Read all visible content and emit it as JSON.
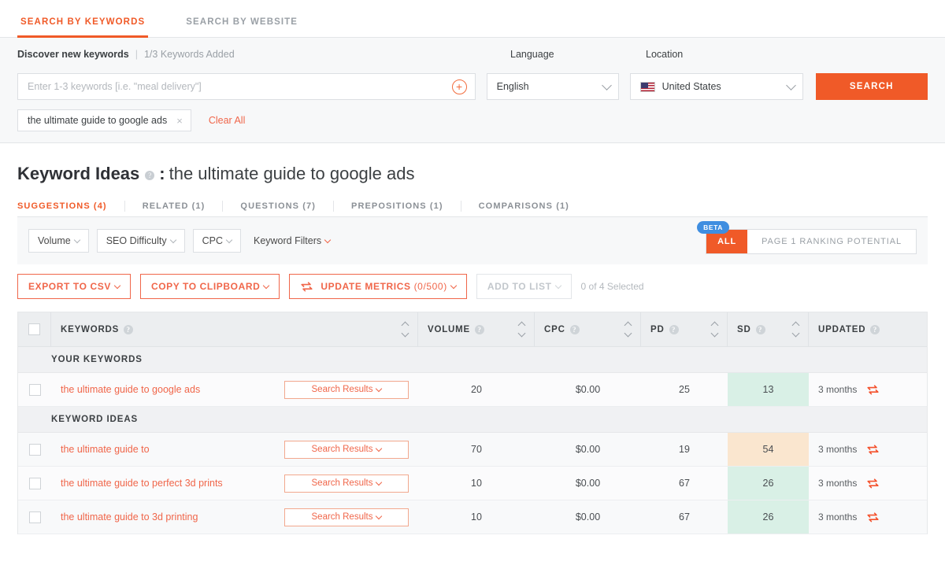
{
  "top_tabs": [
    {
      "label": "SEARCH BY KEYWORDS",
      "active": true
    },
    {
      "label": "SEARCH BY WEBSITE",
      "active": false
    }
  ],
  "search_panel": {
    "discover_label": "Discover new keywords",
    "separator": "|",
    "added_label": "1/3 Keywords Added",
    "keyword_input_placeholder": "Enter 1-3 keywords [i.e. \"meal delivery\"]",
    "keyword_input_value": "",
    "language_label": "Language",
    "language_value": "English",
    "location_label": "Location",
    "location_value": "United States",
    "search_button": "SEARCH",
    "chips": [
      {
        "label": "the ultimate guide to google ads",
        "remove": "×"
      }
    ],
    "clear_all": "Clear All"
  },
  "heading": {
    "title": "Keyword Ideas",
    "info": "?",
    "colon": ":",
    "query": "the ultimate guide to google ads"
  },
  "sub_tabs": [
    {
      "label": "SUGGESTIONS (4)",
      "active": true
    },
    {
      "label": "RELATED (1)",
      "active": false
    },
    {
      "label": "QUESTIONS (7)",
      "active": false
    },
    {
      "label": "PREPOSITIONS (1)",
      "active": false
    },
    {
      "label": "COMPARISONS (1)",
      "active": false
    }
  ],
  "filters": {
    "chips": [
      "Volume",
      "SEO Difficulty",
      "CPC"
    ],
    "keyword_filters": "Keyword Filters",
    "toggle": {
      "beta_badge": "BETA",
      "all": "ALL",
      "page1": "PAGE 1 RANKING POTENTIAL"
    }
  },
  "actions": {
    "export": "EXPORT TO CSV",
    "copy": "COPY TO CLIPBOARD",
    "update_metrics": "UPDATE METRICS",
    "update_metrics_count": "(0/500)",
    "add_to_list": "ADD TO LIST",
    "selected_count": "0 of 4 Selected"
  },
  "table": {
    "columns": [
      {
        "key": "keywords",
        "label": "KEYWORDS",
        "sortable": true,
        "info": true
      },
      {
        "key": "volume",
        "label": "VOLUME",
        "sortable": true,
        "info": true
      },
      {
        "key": "cpc",
        "label": "CPC",
        "sortable": true,
        "info": true
      },
      {
        "key": "pd",
        "label": "PD",
        "sortable": true,
        "info": true
      },
      {
        "key": "sd",
        "label": "SD",
        "sortable": true,
        "info": true
      },
      {
        "key": "updated",
        "label": "UPDATED",
        "sortable": false,
        "info": true
      }
    ],
    "groups": [
      {
        "label": "YOUR KEYWORDS",
        "rows": [
          {
            "keyword": "the ultimate guide to google ads",
            "search_results_label": "Search Results",
            "volume": "20",
            "cpc": "$0.00",
            "pd": "25",
            "sd": "13",
            "sd_color": "green",
            "updated": "3 months"
          }
        ]
      },
      {
        "label": "KEYWORD IDEAS",
        "rows": [
          {
            "keyword": "the ultimate guide to",
            "search_results_label": "Search Results",
            "volume": "70",
            "cpc": "$0.00",
            "pd": "19",
            "sd": "54",
            "sd_color": "peach",
            "updated": "3 months"
          },
          {
            "keyword": "the ultimate guide to perfect 3d prints",
            "search_results_label": "Search Results",
            "volume": "10",
            "cpc": "$0.00",
            "pd": "67",
            "sd": "26",
            "sd_color": "green",
            "updated": "3 months"
          },
          {
            "keyword": "the ultimate guide to 3d printing",
            "search_results_label": "Search Results",
            "volume": "10",
            "cpc": "$0.00",
            "pd": "67",
            "sd": "26",
            "sd_color": "green",
            "updated": "3 months"
          }
        ]
      }
    ]
  },
  "colors": {
    "accent": "#f05a28",
    "accent_light": "#f0664a",
    "beta_blue": "#3f8ee0",
    "sd_green": "#d9f0e6",
    "sd_peach": "#fae6cf"
  },
  "icons": {
    "plus": "+",
    "chip_remove": "×"
  }
}
